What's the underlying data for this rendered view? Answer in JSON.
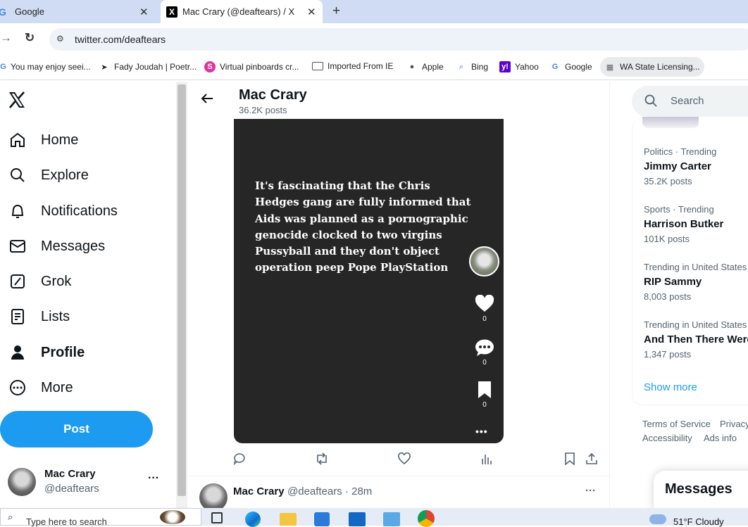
{
  "browser": {
    "tabs": [
      {
        "title": "Google",
        "close": "✕"
      },
      {
        "title": "Mac Crary (@deaftears) / X",
        "close": "✕"
      }
    ],
    "new_tab": "+",
    "url": "twitter.com/deaftears",
    "bookmarks": [
      "You may enjoy seei...",
      "Fady Joudah | Poetr...",
      "Virtual pinboards cr...",
      "Imported From IE",
      "Apple",
      "Bing",
      "Yahoo",
      "Google",
      "WA State Licensing..."
    ]
  },
  "nav": {
    "logo": "X",
    "items": [
      "Home",
      "Explore",
      "Notifications",
      "Messages",
      "Grok",
      "Lists",
      "Profile",
      "More"
    ],
    "post_label": "Post",
    "account": {
      "name": "Mac Crary",
      "handle": "@deaftears",
      "menu": "···"
    }
  },
  "header": {
    "name": "Mac Crary",
    "posts": "36.2K posts"
  },
  "video": {
    "text": "It's fascinating that the Chris Hedges gang are fully informed that  Aids was planned as a pornographic genocide clocked to two virgins Pussyball and they don't  object operation peep Pope PlayStation",
    "like_count": "0",
    "comment_count": "0",
    "bookmark_count": "0",
    "more": "•••"
  },
  "next_tweet": {
    "name": "Mac Crary",
    "meta": "@deaftears · 28m",
    "menu": "···"
  },
  "search": {
    "placeholder": "Search"
  },
  "trends": [
    {
      "category": "Politics · Trending",
      "name": "Jimmy Carter",
      "count": "35.2K posts"
    },
    {
      "category": "Sports · Trending",
      "name": "Harrison Butker",
      "count": "101K posts"
    },
    {
      "category": "Trending in United States",
      "name": "RIP Sammy",
      "count": "8,003 posts"
    },
    {
      "category": "Trending in United States",
      "name": "And Then There Were",
      "count": "1,347 posts"
    }
  ],
  "show_more": "Show more",
  "footer": {
    "links": [
      "Terms of Service",
      "Privacy",
      "Accessibility",
      "Ads info"
    ]
  },
  "messages_drawer": "Messages",
  "taskbar": {
    "search": "Type here to search",
    "weather": "51°F  Cloudy"
  },
  "colors": {
    "accent": "#1d9bf0",
    "video_bg": "#262626"
  }
}
